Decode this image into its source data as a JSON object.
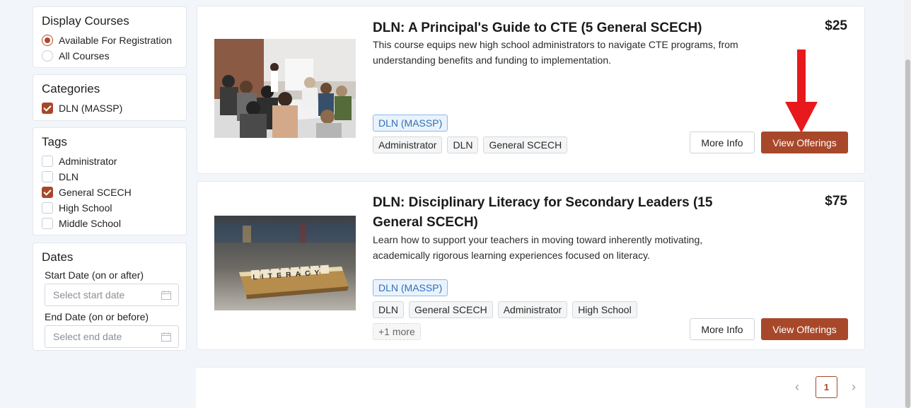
{
  "sidebar": {
    "display": {
      "title": "Display Courses",
      "options": [
        {
          "label": "Available For Registration",
          "selected": true
        },
        {
          "label": "All Courses",
          "selected": false
        }
      ]
    },
    "categories": {
      "title": "Categories",
      "options": [
        {
          "label": "DLN (MASSP)",
          "checked": true
        }
      ]
    },
    "tags": {
      "title": "Tags",
      "options": [
        {
          "label": "Administrator",
          "checked": false
        },
        {
          "label": "DLN",
          "checked": false
        },
        {
          "label": "General SCECH",
          "checked": true
        },
        {
          "label": "High School",
          "checked": false
        },
        {
          "label": "Middle School",
          "checked": false
        }
      ]
    },
    "dates": {
      "title": "Dates",
      "start_label": "Start Date (on or after)",
      "start_placeholder": "Select start date",
      "end_label": "End Date (on or before)",
      "end_placeholder": "Select end date"
    }
  },
  "courses": [
    {
      "title": "DLN: A Principal's Guide to CTE (5 General SCECH)",
      "description": "This course equips new high school administrators to navigate CTE programs, from understanding benefits and funding to implementation.",
      "price": "$25",
      "category": "DLN (MASSP)",
      "tags": [
        "Administrator",
        "DLN",
        "General SCECH"
      ],
      "more_info_label": "More Info",
      "view_label": "View Offerings"
    },
    {
      "title": "DLN: Disciplinary Literacy for Secondary Leaders (15 General SCECH)",
      "description": "Learn how to support your teachers in moving toward inherently motivating, academically rigorous learning experiences focused on literacy.",
      "price": "$75",
      "category": "DLN (MASSP)",
      "tags": [
        "DLN",
        "General SCECH",
        "Administrator",
        "High School"
      ],
      "extra_tags": "+1 more",
      "more_info_label": "More Info",
      "view_label": "View Offerings",
      "image_text": "LITERACY"
    }
  ],
  "pagination": {
    "prev": "‹",
    "current": "1",
    "next": "›"
  },
  "colors": {
    "accent": "#a8482a",
    "category_chip": "#2f6fb8",
    "annotation_arrow": "#e8191c"
  }
}
